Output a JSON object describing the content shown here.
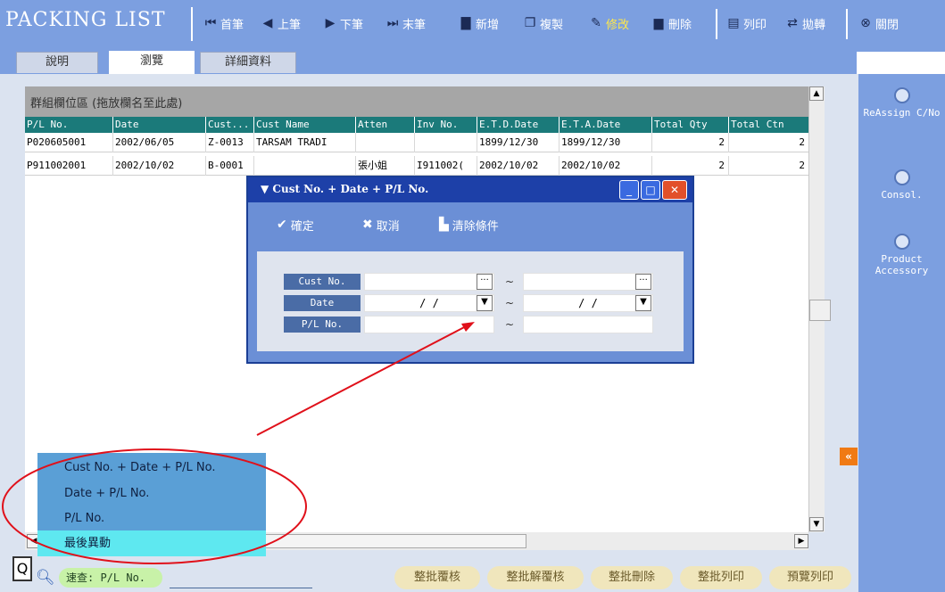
{
  "app": {
    "title": "PACKING LIST"
  },
  "toolbar": {
    "first": "首筆",
    "prev": "上筆",
    "next": "下筆",
    "last": "末筆",
    "add": "新增",
    "copy": "複製",
    "edit": "修改",
    "delete": "刪除",
    "print": "列印",
    "transfer": "拋轉",
    "close": "關閉"
  },
  "tabs": [
    "說明",
    "瀏覽",
    "詳細資料"
  ],
  "grid": {
    "group_hint": "群組欄位區 (拖放欄名至此處)",
    "columns": [
      "P/L No.",
      "Date",
      "Cust...",
      "Cust Name",
      "Atten",
      "Inv No.",
      "E.T.D.Date",
      "E.T.A.Date",
      "Total Qty",
      "Total Ctn"
    ],
    "rows": [
      [
        "P020605001",
        "2002/06/05",
        "Z-0013",
        "TARSAM TRADI",
        "",
        "",
        "1899/12/30",
        "1899/12/30",
        "2",
        "2"
      ],
      [
        "P911002001",
        "2002/10/02",
        "B-0001",
        "",
        "張小姐",
        "I911002(",
        "2002/10/02",
        "2002/10/02",
        "2",
        "2"
      ]
    ]
  },
  "side_panel": {
    "items": [
      "ReAssign C/No",
      "Consol.",
      "Product Accessory"
    ]
  },
  "dialog": {
    "title": "Cust No. + Date + P/L No.",
    "ok": "確定",
    "cancel": "取消",
    "clear": "清除條件",
    "fields": [
      {
        "label": "Cust No.",
        "from": "",
        "to": ""
      },
      {
        "label": "Date",
        "from": "/ /",
        "to": "/ /"
      },
      {
        "label": "P/L No.",
        "from": "",
        "to": ""
      }
    ],
    "range_sep": "~"
  },
  "dropdown": {
    "items": [
      "Cust No. + Date + P/L No.",
      "Date + P/L No.",
      "P/L No.",
      "最後異動"
    ],
    "selected_index": 3
  },
  "bottom": {
    "quick_search_label": "速查: P/L No.",
    "quick_search_value": "",
    "buttons": [
      "整批覆核",
      "整批解覆核",
      "整批刪除",
      "整批列印",
      "預覽列印"
    ]
  },
  "colors": {
    "toolbar": "#7c9fe0",
    "grid_header": "#1b7a7a",
    "dialog_title": "#1d40a8",
    "annotation": "#e0101a"
  }
}
